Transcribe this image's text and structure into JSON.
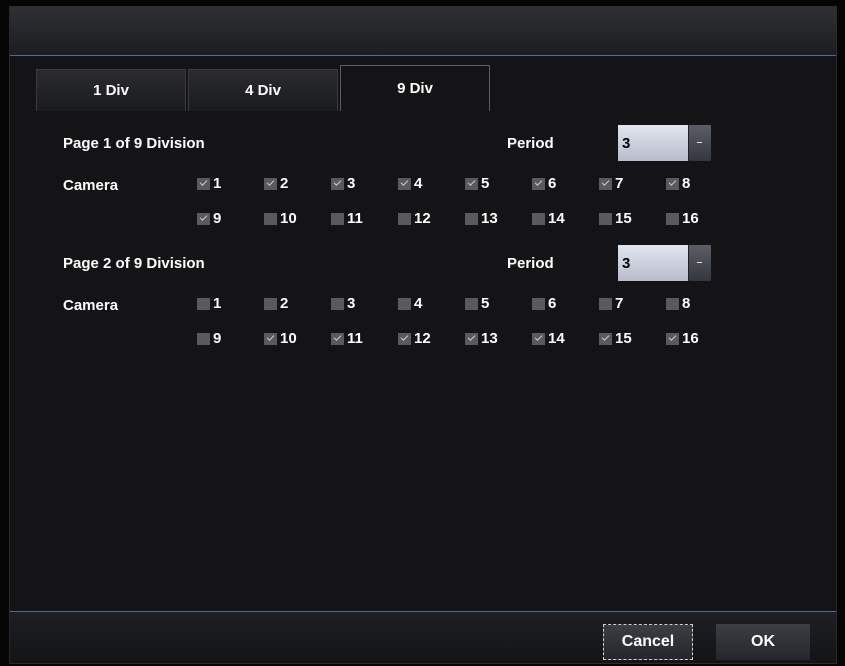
{
  "tabs": [
    {
      "label": "1 Div",
      "active": false
    },
    {
      "label": "4 Div",
      "active": false
    },
    {
      "label": "9 Div",
      "active": true
    }
  ],
  "pages": [
    {
      "title": "Page 1 of 9 Division",
      "period_label": "Period",
      "period_value": "3",
      "camera_label": "Camera",
      "cameras": [
        {
          "num": "1",
          "checked": true
        },
        {
          "num": "2",
          "checked": true
        },
        {
          "num": "3",
          "checked": true
        },
        {
          "num": "4",
          "checked": true
        },
        {
          "num": "5",
          "checked": true
        },
        {
          "num": "6",
          "checked": true
        },
        {
          "num": "7",
          "checked": true
        },
        {
          "num": "8",
          "checked": true
        },
        {
          "num": "9",
          "checked": true
        },
        {
          "num": "10",
          "checked": false
        },
        {
          "num": "11",
          "checked": false
        },
        {
          "num": "12",
          "checked": false
        },
        {
          "num": "13",
          "checked": false
        },
        {
          "num": "14",
          "checked": false
        },
        {
          "num": "15",
          "checked": false
        },
        {
          "num": "16",
          "checked": false
        }
      ]
    },
    {
      "title": "Page 2 of 9 Division",
      "period_label": "Period",
      "period_value": "3",
      "camera_label": "Camera",
      "cameras": [
        {
          "num": "1",
          "checked": false
        },
        {
          "num": "2",
          "checked": false
        },
        {
          "num": "3",
          "checked": false
        },
        {
          "num": "4",
          "checked": false
        },
        {
          "num": "5",
          "checked": false
        },
        {
          "num": "6",
          "checked": false
        },
        {
          "num": "7",
          "checked": false
        },
        {
          "num": "8",
          "checked": false
        },
        {
          "num": "9",
          "checked": false
        },
        {
          "num": "10",
          "checked": true
        },
        {
          "num": "11",
          "checked": true
        },
        {
          "num": "12",
          "checked": true
        },
        {
          "num": "13",
          "checked": true
        },
        {
          "num": "14",
          "checked": true
        },
        {
          "num": "15",
          "checked": true
        },
        {
          "num": "16",
          "checked": true
        }
      ]
    }
  ],
  "footer": {
    "cancel_label": "Cancel",
    "ok_label": "OK"
  }
}
